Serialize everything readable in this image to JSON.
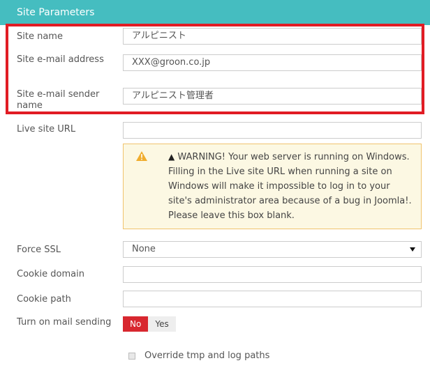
{
  "header": {
    "title": "Site Parameters"
  },
  "fields": {
    "site_name": {
      "label": "Site name",
      "value": "アルピニスト"
    },
    "site_email": {
      "label": "Site e-mail address",
      "value": "XXX@groon.co.jp"
    },
    "site_email_sender": {
      "label": "Site e-mail sender name",
      "value": "アルピニスト管理者"
    },
    "live_site_url": {
      "label": "Live site URL",
      "value": ""
    },
    "force_ssl": {
      "label": "Force SSL",
      "value": "None"
    },
    "cookie_domain": {
      "label": "Cookie domain",
      "value": ""
    },
    "cookie_path": {
      "label": "Cookie path",
      "value": ""
    },
    "mail_sending": {
      "label": "Turn on mail sending",
      "options": [
        "No",
        "Yes"
      ],
      "selected": "No"
    }
  },
  "warning": {
    "glyph": "▲",
    "text": "WARNING! Your web server is running on Windows. Filling in the Live site URL when running a site on Windows will make it impossible to log in to your site's administrator area because of a bug in Joomla!. Please leave this box blank."
  },
  "override": {
    "label": "Override tmp and log paths"
  },
  "colors": {
    "header_bg": "#45bdc0",
    "highlight_border": "#e11c24",
    "warning_bg": "#fcf8e3",
    "warning_border": "#f0c36d",
    "toggle_active": "#d8272f"
  },
  "icons": {
    "warning": "warning-triangle-icon",
    "select": "caret-down-icon"
  }
}
